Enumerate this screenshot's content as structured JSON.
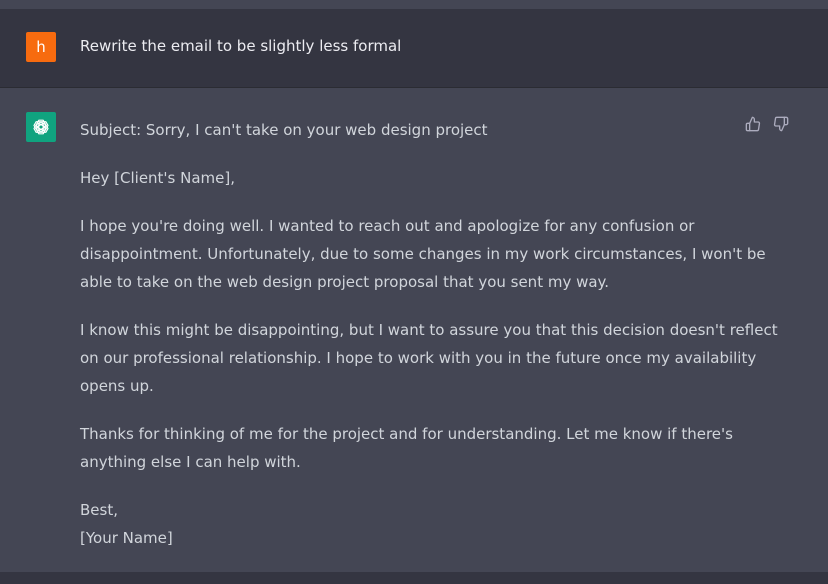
{
  "conversation": {
    "user_message": {
      "avatar_letter": "h",
      "avatar_color": "#f76b0f",
      "text": "Rewrite the email to be slightly less formal"
    },
    "assistant_message": {
      "avatar_icon": "openai-logo-icon",
      "avatar_color": "#10a37f",
      "subject": "Subject: Sorry, I can't take on your web design project",
      "greeting": "Hey [Client's Name],",
      "paragraph1": [
        "I hope you're doing well. I wanted to reach out and apologize for any confusion or",
        "disappointment. Unfortunately, due to some changes in my work circumstances, I won't be",
        "able to take on the web design project proposal that you sent my way."
      ],
      "paragraph2": [
        "I know this might be disappointing, but I want to assure you that this decision doesn't reflect",
        "on our professional relationship. I hope to work with you in the future once my availability",
        "opens up."
      ],
      "paragraph3": [
        "Thanks for thinking of me for the project and for understanding. Let me know if there's",
        "anything else I can help with."
      ],
      "signoff": "Best,",
      "name": "[Your Name]"
    },
    "feedback": {
      "like_icon": "thumbs-up-icon",
      "dislike_icon": "thumbs-down-icon"
    }
  },
  "colors": {
    "user_bg": "#343541",
    "assistant_bg": "#444654",
    "text": "#d1d5db"
  }
}
